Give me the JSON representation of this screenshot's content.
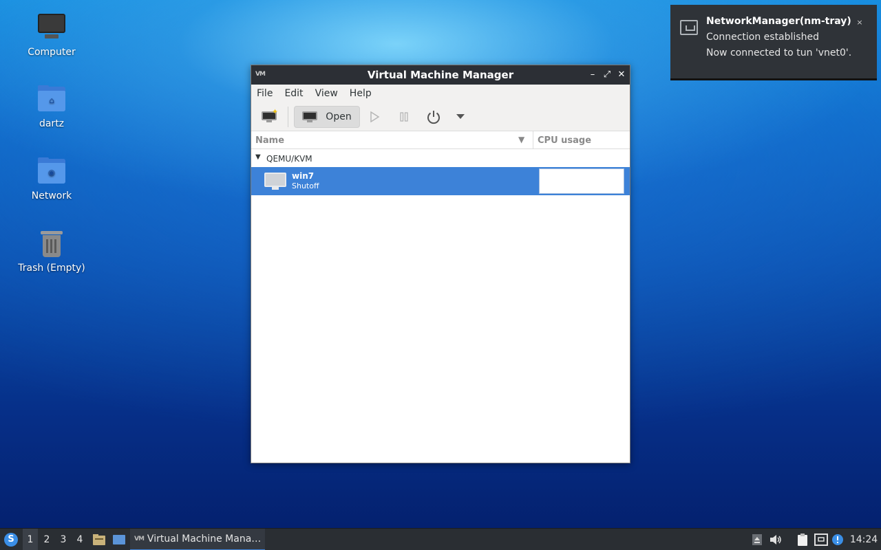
{
  "desktop": {
    "icons": [
      {
        "label": "Computer",
        "icon": "computer-icon"
      },
      {
        "label": "dartz",
        "icon": "home-folder-icon"
      },
      {
        "label": "Network",
        "icon": "network-folder-icon"
      },
      {
        "label": "Trash (Empty)",
        "icon": "trash-icon"
      }
    ]
  },
  "window": {
    "title": "Virtual Machine Manager",
    "app_icon_text": "VM",
    "controls": {
      "minimize": "–",
      "maximize": "⤢",
      "close": "✕"
    },
    "menu": [
      "File",
      "Edit",
      "View",
      "Help"
    ],
    "toolbar": {
      "open_label": "Open"
    },
    "columns": {
      "name": "Name",
      "cpu": "CPU usage"
    },
    "group": "QEMU/KVM",
    "vm": {
      "name": "win7",
      "status": "Shutoff"
    }
  },
  "notification": {
    "title": "NetworkManager(nm-tray)",
    "line1": "Connection established",
    "line2": "Now connected to tun 'vnet0'.",
    "close": "×"
  },
  "taskbar": {
    "workspaces": [
      "1",
      "2",
      "3",
      "4"
    ],
    "active_workspace": "1",
    "task_label": "Virtual Machine Mana…",
    "clock": "14:24"
  },
  "colors": {
    "accent": "#3d82d8",
    "titlebar": "#2c2f35",
    "taskbar": "#2a2e33"
  }
}
